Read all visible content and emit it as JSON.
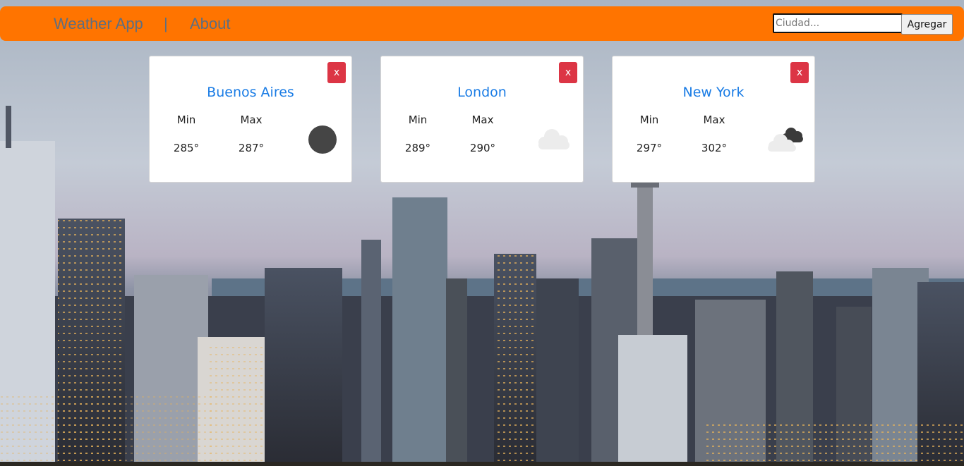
{
  "navbar": {
    "brand": "Weather App",
    "separator": "|",
    "about": "About",
    "search_placeholder": "Ciudad...",
    "add_label": "Agregar",
    "color": "#ff7400"
  },
  "cards": [
    {
      "city": "Buenos Aires",
      "min_label": "Min",
      "max_label": "Max",
      "min": "285°",
      "max": "287°",
      "close_label": "x",
      "icon": "clear-night-icon"
    },
    {
      "city": "London",
      "min_label": "Min",
      "max_label": "Max",
      "min": "289°",
      "max": "290°",
      "close_label": "x",
      "icon": "cloud-icon"
    },
    {
      "city": "New York",
      "min_label": "Min",
      "max_label": "Max",
      "min": "297°",
      "max": "302°",
      "close_label": "x",
      "icon": "broken-clouds-icon"
    }
  ],
  "colors": {
    "city_link": "#1a7ce5",
    "close_button": "#dc3545"
  }
}
